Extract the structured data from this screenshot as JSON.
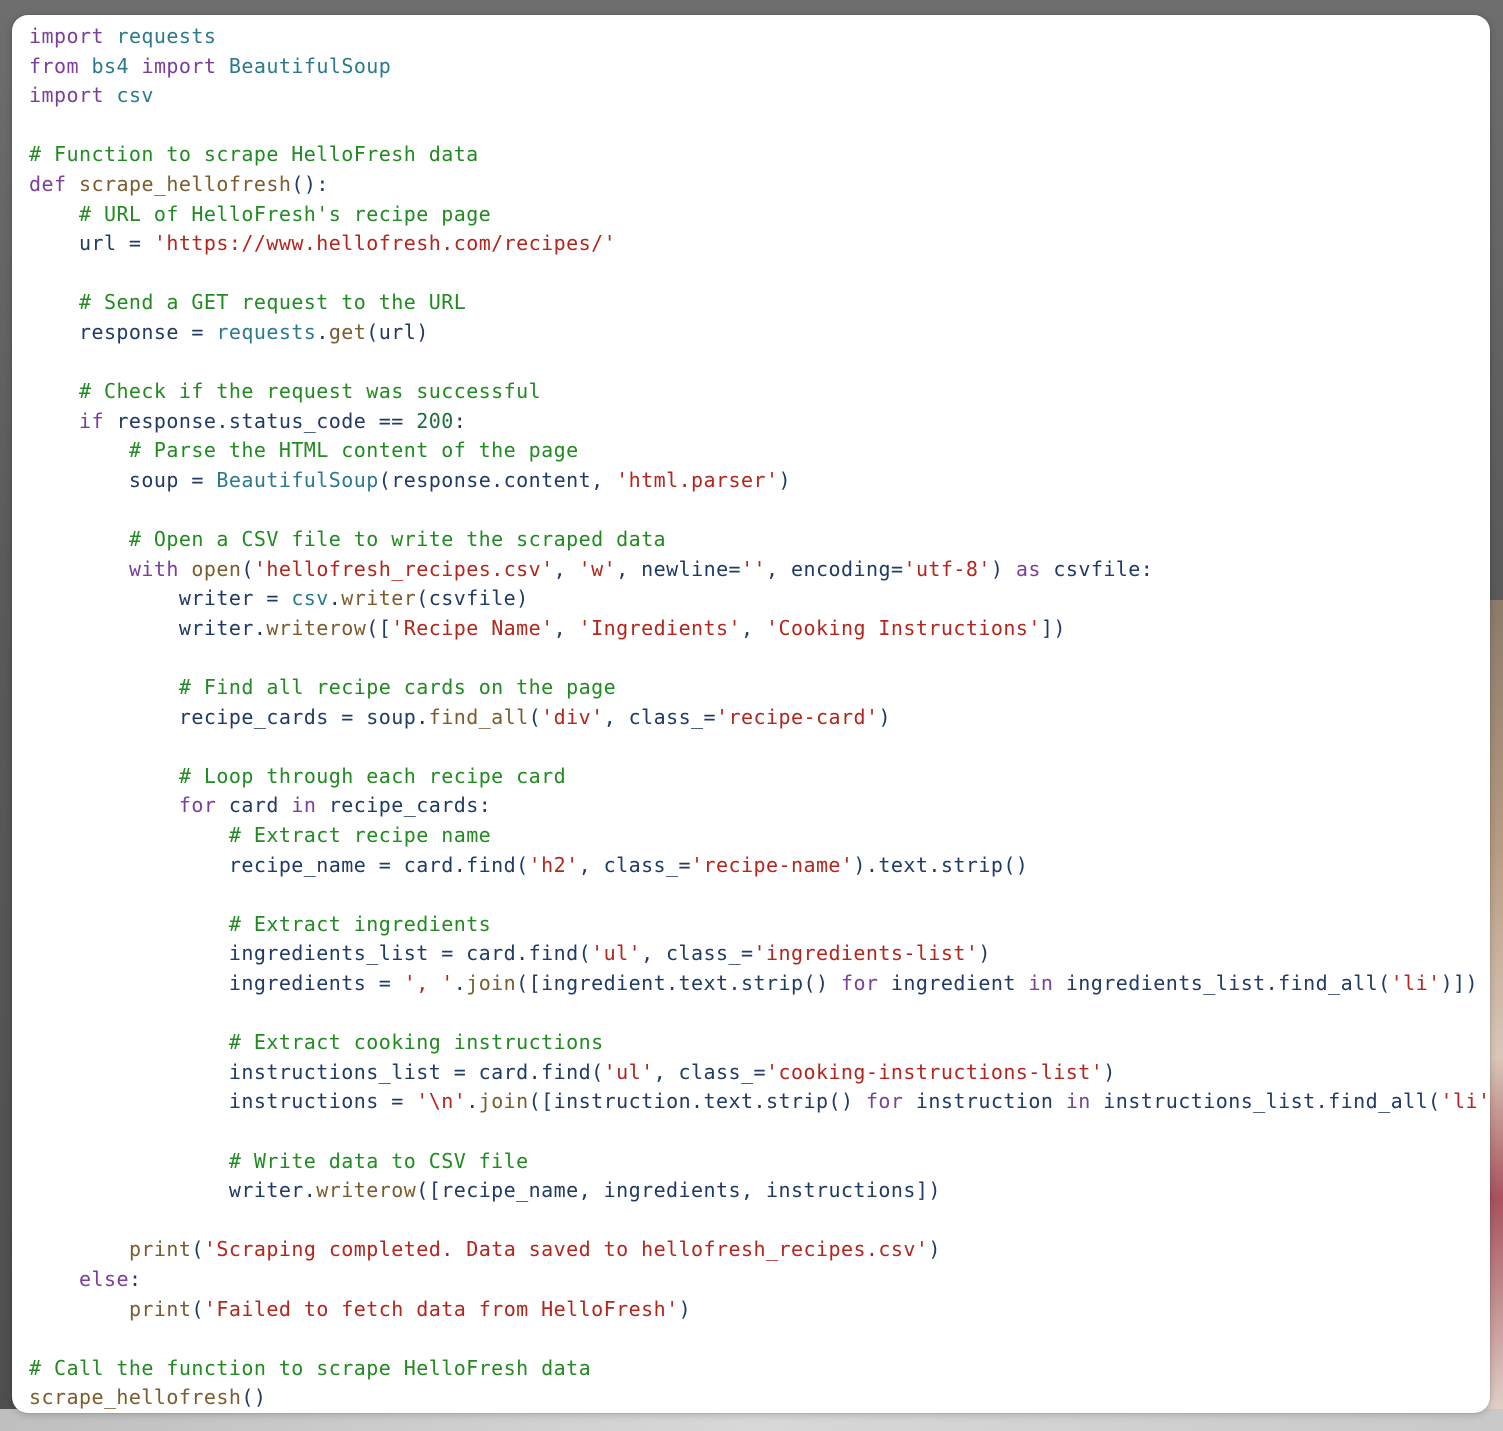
{
  "code": {
    "language": "python",
    "lines": [
      [
        {
          "t": "import",
          "c": "kw"
        },
        {
          "t": " ",
          "c": "pl"
        },
        {
          "t": "requests",
          "c": "mod"
        }
      ],
      [
        {
          "t": "from",
          "c": "kw"
        },
        {
          "t": " ",
          "c": "pl"
        },
        {
          "t": "bs4",
          "c": "mod"
        },
        {
          "t": " ",
          "c": "pl"
        },
        {
          "t": "import",
          "c": "kw"
        },
        {
          "t": " ",
          "c": "pl"
        },
        {
          "t": "BeautifulSoup",
          "c": "mod"
        }
      ],
      [
        {
          "t": "import",
          "c": "kw"
        },
        {
          "t": " ",
          "c": "pl"
        },
        {
          "t": "csv",
          "c": "mod"
        }
      ],
      [],
      [
        {
          "t": "# Function to scrape HelloFresh data",
          "c": "cm"
        }
      ],
      [
        {
          "t": "def",
          "c": "kw"
        },
        {
          "t": " ",
          "c": "pl"
        },
        {
          "t": "scrape_hellofresh",
          "c": "fn"
        },
        {
          "t": "():",
          "c": "pl"
        }
      ],
      [
        {
          "t": "    ",
          "c": "pl"
        },
        {
          "t": "# URL of HelloFresh's recipe page",
          "c": "cm"
        }
      ],
      [
        {
          "t": "    url = ",
          "c": "pl"
        },
        {
          "t": "'https://www.hellofresh.com/recipes/'",
          "c": "str"
        }
      ],
      [],
      [
        {
          "t": "    ",
          "c": "pl"
        },
        {
          "t": "# Send a GET request to the URL",
          "c": "cm"
        }
      ],
      [
        {
          "t": "    response = ",
          "c": "pl"
        },
        {
          "t": "requests",
          "c": "mod"
        },
        {
          "t": ".",
          "c": "pl"
        },
        {
          "t": "get",
          "c": "fn"
        },
        {
          "t": "(url)",
          "c": "pl"
        }
      ],
      [],
      [
        {
          "t": "    ",
          "c": "pl"
        },
        {
          "t": "# Check if the request was successful",
          "c": "cm"
        }
      ],
      [
        {
          "t": "    ",
          "c": "pl"
        },
        {
          "t": "if",
          "c": "kw"
        },
        {
          "t": " response.status_code == ",
          "c": "pl"
        },
        {
          "t": "200",
          "c": "num"
        },
        {
          "t": ":",
          "c": "pl"
        }
      ],
      [
        {
          "t": "        ",
          "c": "pl"
        },
        {
          "t": "# Parse the HTML content of the page",
          "c": "cm"
        }
      ],
      [
        {
          "t": "        soup = ",
          "c": "pl"
        },
        {
          "t": "BeautifulSoup",
          "c": "mod"
        },
        {
          "t": "(response.content, ",
          "c": "pl"
        },
        {
          "t": "'html.parser'",
          "c": "str"
        },
        {
          "t": ")",
          "c": "pl"
        }
      ],
      [],
      [
        {
          "t": "        ",
          "c": "pl"
        },
        {
          "t": "# Open a CSV file to write the scraped data",
          "c": "cm"
        }
      ],
      [
        {
          "t": "        ",
          "c": "pl"
        },
        {
          "t": "with",
          "c": "kw"
        },
        {
          "t": " ",
          "c": "pl"
        },
        {
          "t": "open",
          "c": "fn"
        },
        {
          "t": "(",
          "c": "pl"
        },
        {
          "t": "'hellofresh_recipes.csv'",
          "c": "str"
        },
        {
          "t": ", ",
          "c": "pl"
        },
        {
          "t": "'w'",
          "c": "str"
        },
        {
          "t": ", newline=",
          "c": "pl"
        },
        {
          "t": "''",
          "c": "str"
        },
        {
          "t": ", encoding=",
          "c": "pl"
        },
        {
          "t": "'utf-8'",
          "c": "str"
        },
        {
          "t": ") ",
          "c": "pl"
        },
        {
          "t": "as",
          "c": "kw"
        },
        {
          "t": " csvfile:",
          "c": "pl"
        }
      ],
      [
        {
          "t": "            writer = ",
          "c": "pl"
        },
        {
          "t": "csv",
          "c": "mod"
        },
        {
          "t": ".",
          "c": "pl"
        },
        {
          "t": "writer",
          "c": "fn"
        },
        {
          "t": "(csvfile)",
          "c": "pl"
        }
      ],
      [
        {
          "t": "            writer.",
          "c": "pl"
        },
        {
          "t": "writerow",
          "c": "fn"
        },
        {
          "t": "([",
          "c": "pl"
        },
        {
          "t": "'Recipe Name'",
          "c": "str"
        },
        {
          "t": ", ",
          "c": "pl"
        },
        {
          "t": "'Ingredients'",
          "c": "str"
        },
        {
          "t": ", ",
          "c": "pl"
        },
        {
          "t": "'Cooking Instructions'",
          "c": "str"
        },
        {
          "t": "])",
          "c": "pl"
        }
      ],
      [],
      [
        {
          "t": "            ",
          "c": "pl"
        },
        {
          "t": "# Find all recipe cards on the page",
          "c": "cm"
        }
      ],
      [
        {
          "t": "            recipe_cards = soup.",
          "c": "pl"
        },
        {
          "t": "find_all",
          "c": "fn"
        },
        {
          "t": "(",
          "c": "pl"
        },
        {
          "t": "'div'",
          "c": "str"
        },
        {
          "t": ", class_=",
          "c": "pl"
        },
        {
          "t": "'recipe-card'",
          "c": "str"
        },
        {
          "t": ")",
          "c": "pl"
        }
      ],
      [],
      [
        {
          "t": "            ",
          "c": "pl"
        },
        {
          "t": "# Loop through each recipe card",
          "c": "cm"
        }
      ],
      [
        {
          "t": "            ",
          "c": "pl"
        },
        {
          "t": "for",
          "c": "kw"
        },
        {
          "t": " card ",
          "c": "pl"
        },
        {
          "t": "in",
          "c": "kw"
        },
        {
          "t": " recipe_cards:",
          "c": "pl"
        }
      ],
      [
        {
          "t": "                ",
          "c": "pl"
        },
        {
          "t": "# Extract recipe name",
          "c": "cm"
        }
      ],
      [
        {
          "t": "                recipe_name = card.find(",
          "c": "pl"
        },
        {
          "t": "'h2'",
          "c": "str"
        },
        {
          "t": ", class_=",
          "c": "pl"
        },
        {
          "t": "'recipe-name'",
          "c": "str"
        },
        {
          "t": ").text.strip()",
          "c": "pl"
        }
      ],
      [],
      [
        {
          "t": "                ",
          "c": "pl"
        },
        {
          "t": "# Extract ingredients",
          "c": "cm"
        }
      ],
      [
        {
          "t": "                ingredients_list = card.find(",
          "c": "pl"
        },
        {
          "t": "'ul'",
          "c": "str"
        },
        {
          "t": ", class_=",
          "c": "pl"
        },
        {
          "t": "'ingredients-list'",
          "c": "str"
        },
        {
          "t": ")",
          "c": "pl"
        }
      ],
      [
        {
          "t": "                ingredients = ",
          "c": "pl"
        },
        {
          "t": "', '",
          "c": "str"
        },
        {
          "t": ".",
          "c": "pl"
        },
        {
          "t": "join",
          "c": "fn"
        },
        {
          "t": "([ingredient.text.strip() ",
          "c": "pl"
        },
        {
          "t": "for",
          "c": "kw"
        },
        {
          "t": " ingredient ",
          "c": "pl"
        },
        {
          "t": "in",
          "c": "kw"
        },
        {
          "t": " ingredients_list.find_all(",
          "c": "pl"
        },
        {
          "t": "'li'",
          "c": "str"
        },
        {
          "t": ")])",
          "c": "pl"
        }
      ],
      [],
      [
        {
          "t": "                ",
          "c": "pl"
        },
        {
          "t": "# Extract cooking instructions",
          "c": "cm"
        }
      ],
      [
        {
          "t": "                instructions_list = card.find(",
          "c": "pl"
        },
        {
          "t": "'ul'",
          "c": "str"
        },
        {
          "t": ", class_=",
          "c": "pl"
        },
        {
          "t": "'cooking-instructions-list'",
          "c": "str"
        },
        {
          "t": ")",
          "c": "pl"
        }
      ],
      [
        {
          "t": "                instructions = ",
          "c": "pl"
        },
        {
          "t": "'\\n'",
          "c": "str"
        },
        {
          "t": ".",
          "c": "pl"
        },
        {
          "t": "join",
          "c": "fn"
        },
        {
          "t": "([instruction.text.strip() ",
          "c": "pl"
        },
        {
          "t": "for",
          "c": "kw"
        },
        {
          "t": " instruction ",
          "c": "pl"
        },
        {
          "t": "in",
          "c": "kw"
        },
        {
          "t": " instructions_list.find_all(",
          "c": "pl"
        },
        {
          "t": "'li'",
          "c": "str"
        },
        {
          "t": ")])",
          "c": "pl"
        }
      ],
      [],
      [
        {
          "t": "                ",
          "c": "pl"
        },
        {
          "t": "# Write data to CSV file",
          "c": "cm"
        }
      ],
      [
        {
          "t": "                writer.",
          "c": "pl"
        },
        {
          "t": "writerow",
          "c": "fn"
        },
        {
          "t": "([recipe_name, ingredients, instructions])",
          "c": "pl"
        }
      ],
      [],
      [
        {
          "t": "        ",
          "c": "pl"
        },
        {
          "t": "print",
          "c": "fn"
        },
        {
          "t": "(",
          "c": "pl"
        },
        {
          "t": "'Scraping completed. Data saved to hellofresh_recipes.csv'",
          "c": "str"
        },
        {
          "t": ")",
          "c": "pl"
        }
      ],
      [
        {
          "t": "    ",
          "c": "pl"
        },
        {
          "t": "else",
          "c": "kw"
        },
        {
          "t": ":",
          "c": "pl"
        }
      ],
      [
        {
          "t": "        ",
          "c": "pl"
        },
        {
          "t": "print",
          "c": "fn"
        },
        {
          "t": "(",
          "c": "pl"
        },
        {
          "t": "'Failed to fetch data from HelloFresh'",
          "c": "str"
        },
        {
          "t": ")",
          "c": "pl"
        }
      ],
      [],
      [
        {
          "t": "# Call the function to scrape HelloFresh data",
          "c": "cm"
        }
      ],
      [
        {
          "t": "scrape_hellofresh",
          "c": "fn"
        },
        {
          "t": "()",
          "c": "pl"
        }
      ]
    ]
  },
  "colors": {
    "keyword": "#7a3e9d",
    "module": "#2a7a8c",
    "function": "#7a5c2e",
    "comment": "#218a21",
    "string": "#b3261e",
    "number": "#1f6f3f",
    "plain": "#1f3a66",
    "background": "#ffffff"
  }
}
